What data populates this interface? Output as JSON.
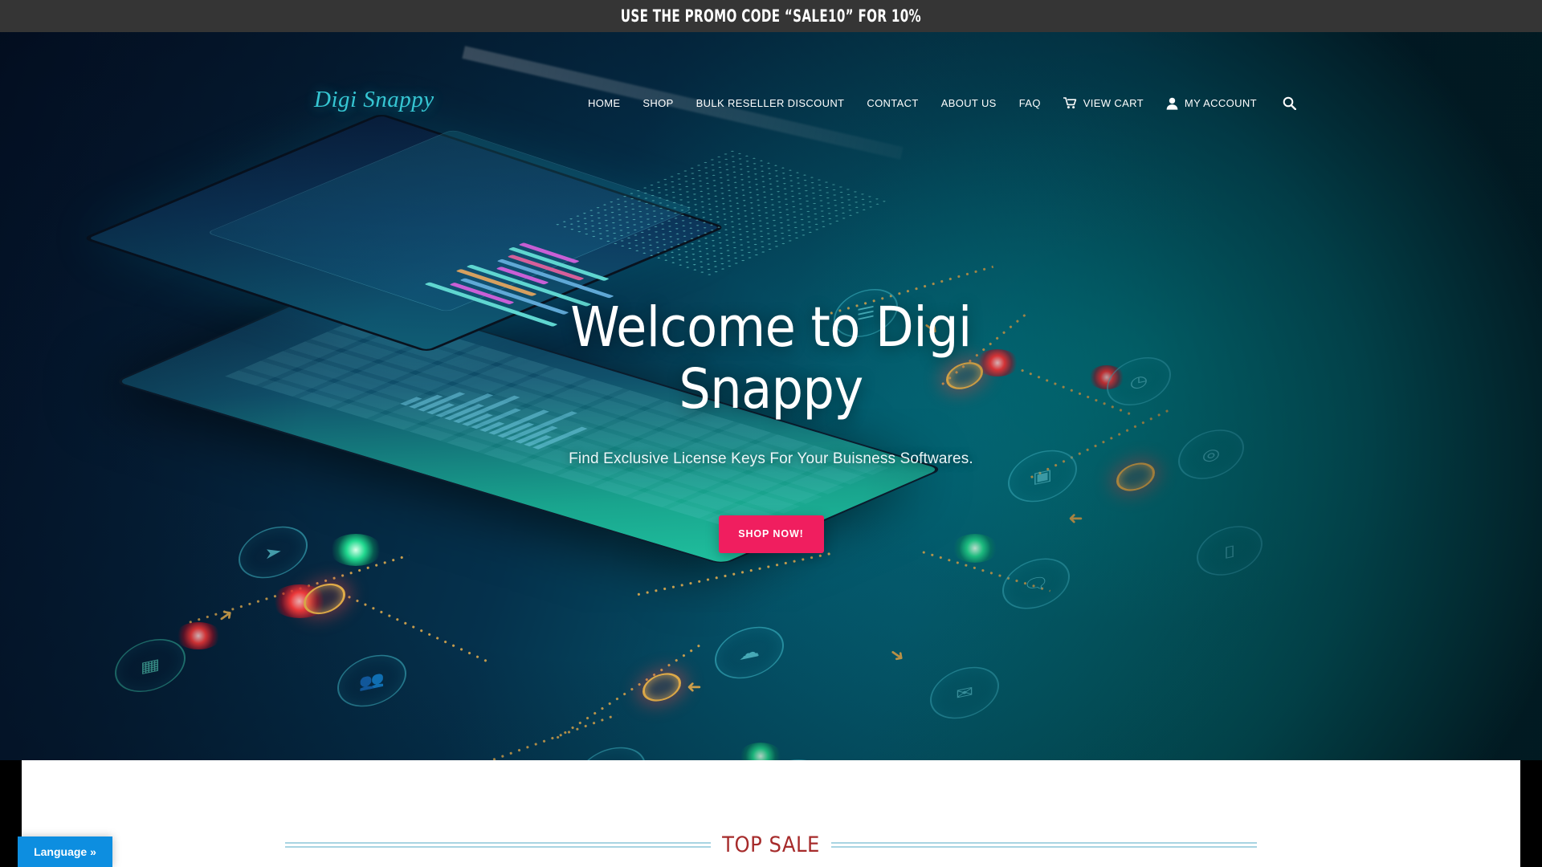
{
  "promo_bar": {
    "text": "USE THE PROMO CODE “SALE10” FOR 10%",
    "bg_color": "#353535"
  },
  "header": {
    "logo": "Digi Snappy",
    "logo_color": "#36c6d3",
    "nav_items": [
      {
        "label": "HOME"
      },
      {
        "label": "SHOP"
      },
      {
        "label": "BULK RESELLER DISCOUNT"
      },
      {
        "label": "CONTACT"
      },
      {
        "label": "ABOUT US"
      },
      {
        "label": "FAQ"
      }
    ],
    "cart": {
      "label": "VIEW CART",
      "icon": "shopping-cart-icon"
    },
    "account": {
      "label": "MY ACCOUNT",
      "icon": "user-icon"
    },
    "search": {
      "icon": "search-icon"
    }
  },
  "hero": {
    "title": "Welcome to Digi Snappy",
    "subtitle": "Find Exclusive License Keys For Your Buisness Softwares.",
    "cta_label": "SHOP NOW!",
    "cta_color": "#f01e5f",
    "background_colors": {
      "dark_navy": "#04142b",
      "mid_blue": "#05314c",
      "teal": "#038a7d"
    },
    "decor_icons": [
      "list-icon",
      "clock-icon",
      "location-pin-icon",
      "image-icon",
      "mobile-icon",
      "chat-icon",
      "cloud-icon",
      "send-icon",
      "cursor-icon",
      "calculator-icon",
      "users-icon",
      "search-circle-icon",
      "wifi-icon",
      "grid-icon"
    ]
  },
  "content": {
    "section_title": "TOP SALE",
    "section_title_color": "#a62b2b",
    "rule_color": "#a8d4e2"
  },
  "language_widget": {
    "label": "Language »",
    "bg_color": "#0d8ee0"
  }
}
